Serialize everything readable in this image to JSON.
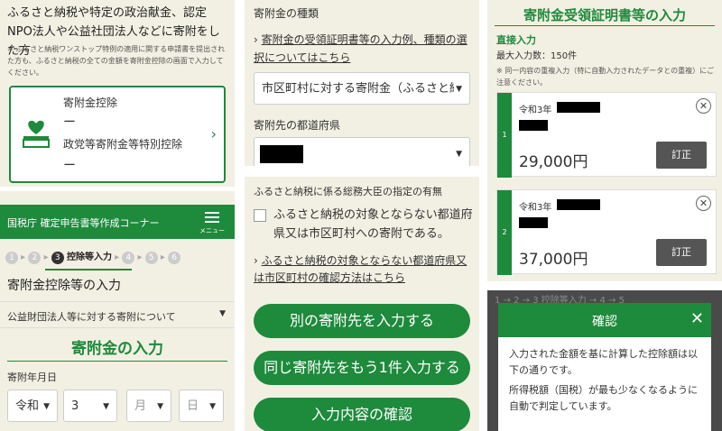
{
  "p1": {
    "intro": "ふるさと納税や特定の政治献金、認定NPO法人や公益社団法人などに寄附をした方",
    "note": "※ ふるさと納税ワンストップ特例の適用に関する申請書を提出された方も、ふるさと納税の全ての金額を寄附金控除の画面で入力してください。",
    "card_label1": "寄附金控除",
    "card_value1": "ー",
    "card_label2": "政党等寄附金等特別控除",
    "card_value2": "ー"
  },
  "p2": {
    "header_title": "国税庁 確定申告書等作成コーナー",
    "menu_label": "メニュー",
    "steps": [
      "1",
      "2",
      "3",
      "4",
      "5",
      "6"
    ],
    "step_current_label": "控除等入力",
    "page_title": "寄附金控除等の入力",
    "select_value": "公益財団法人等に対する寄附について",
    "section_title": "寄附金の入力",
    "date_label": "寄附年月日",
    "era": "令和",
    "year": "3",
    "month_ph": "月",
    "day_ph": "日"
  },
  "p3": {
    "type_label": "寄附金の種類",
    "type_link": "寄附金の受領証明書等の入力例、種類の選択についてはこちら",
    "type_value": "市区町村に対する寄附金（ふるさと納",
    "pref_label": "寄附先の都道府県"
  },
  "p4": {
    "designation_label": "ふるさと納税に係る総務大臣の指定の有無",
    "checkbox_label": "ふるさと納税の対象とならない都道府県又は市区町村への寄附である。",
    "confirm_link": "ふるさと納税の対象とならない都道府県又は市区町村の確認方法はこちら",
    "btn_other": "別の寄附先を入力する",
    "btn_same": "同じ寄附先をもう1件入力する",
    "btn_confirm": "入力内容の確認"
  },
  "p5": {
    "title": "寄附金受領証明書等の入力",
    "direct_label": "直接入力",
    "max_label": "最大入力数：150件",
    "note": "※ 同一内容の重複入力（特に自動入力されたデータとの重複）にご注意ください。",
    "entries": [
      {
        "num": "1",
        "era": "令和3年",
        "amount": "29,000円",
        "edit": "訂正"
      },
      {
        "num": "2",
        "era": "令和3年",
        "amount": "37,000円",
        "edit": "訂正"
      }
    ]
  },
  "p6": {
    "bg_steps": "1 → 2 → 3 控除等入力 → 4 → 5",
    "dialog_title": "確認",
    "dialog_body1": "入力された金額を基に計算した控除額は以下の通りです。",
    "dialog_body2": "所得税額（国税）が最も少なくなるように自動で判定しています。"
  }
}
